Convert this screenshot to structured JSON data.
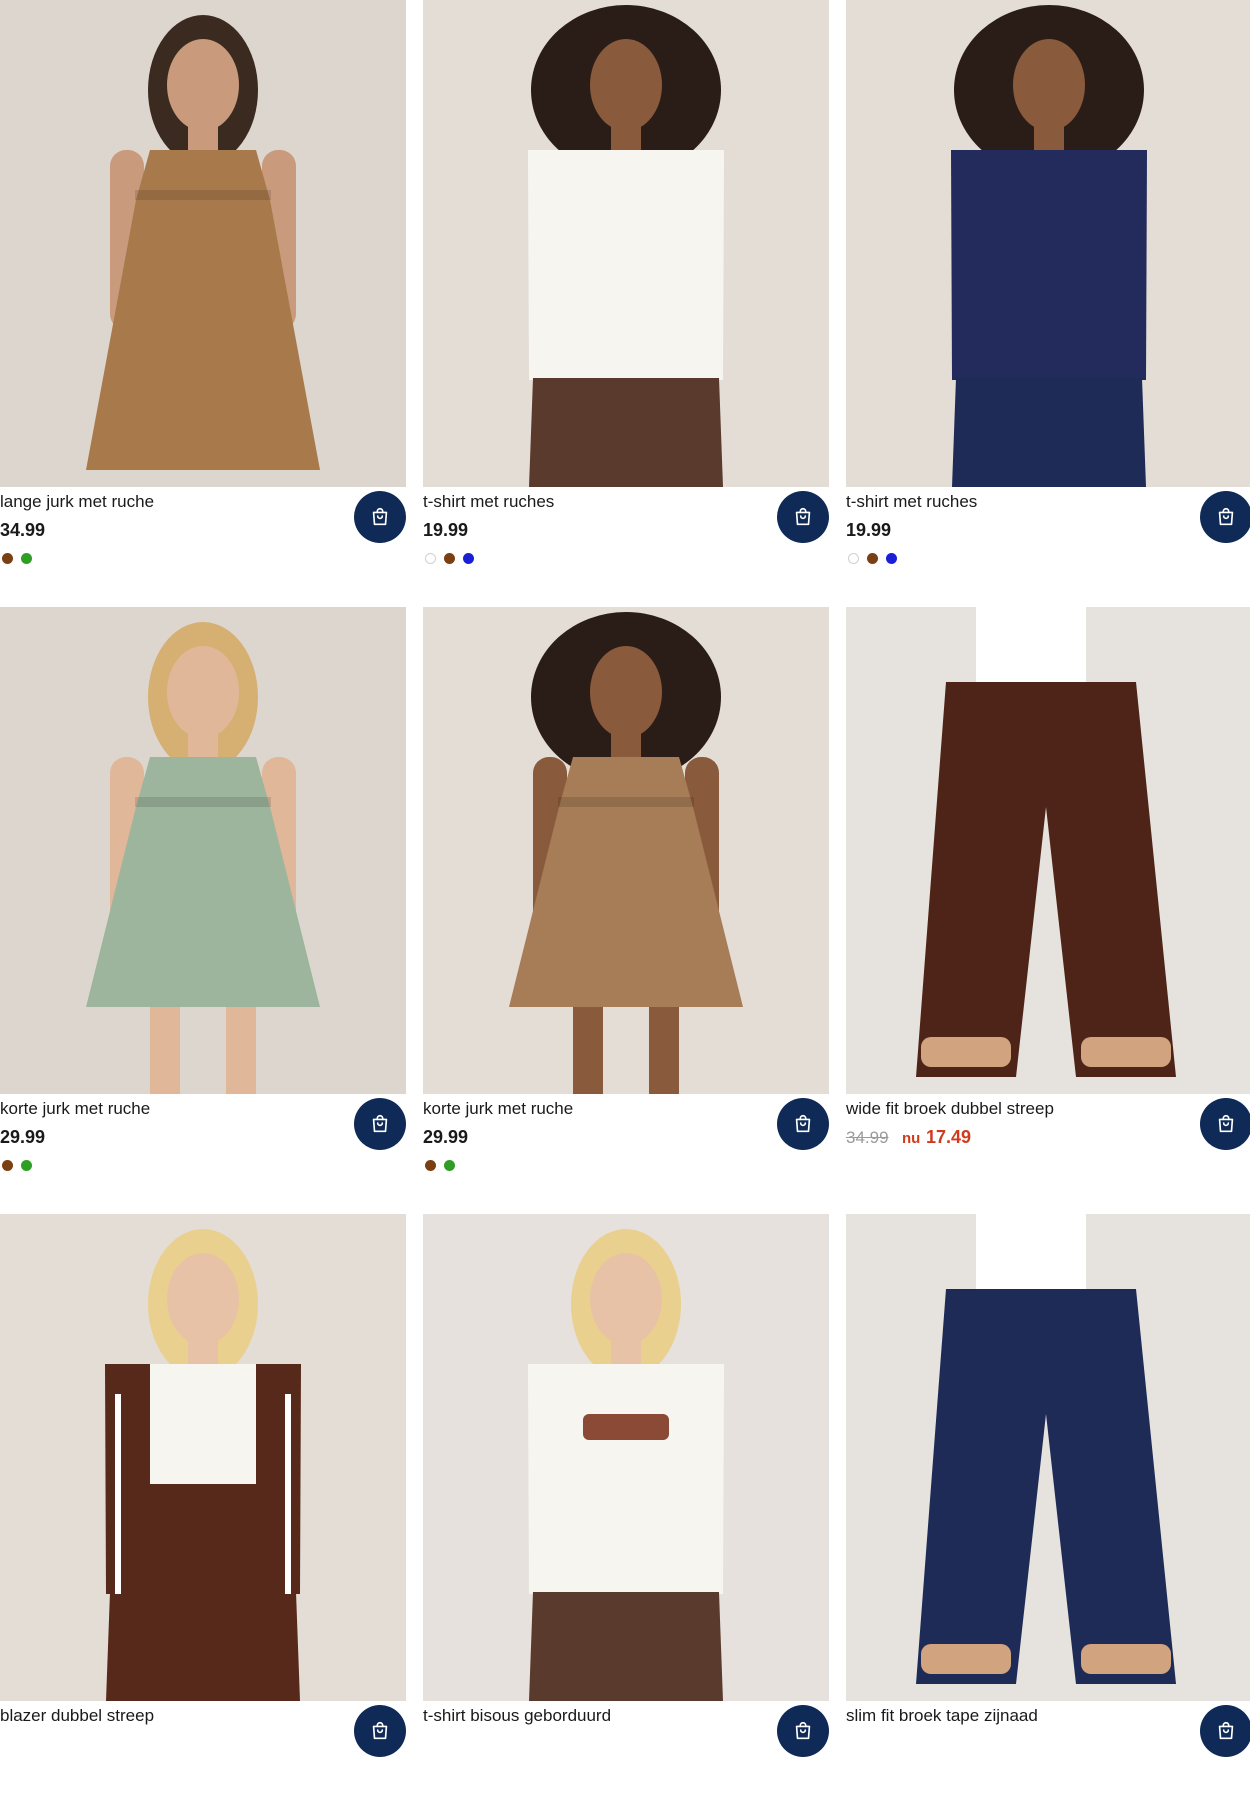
{
  "products": [
    {
      "title": "lange jurk met ruche",
      "price": "34.99",
      "swatches": [
        "#7a3f12",
        "#2e9e24"
      ],
      "palette": {
        "bg": "#ddd6cf",
        "garment": "#a8794a",
        "skin": "#c99a7c",
        "hair": "#3a2a20"
      }
    },
    {
      "title": "t-shirt met ruches",
      "price": "19.99",
      "swatches": [
        "#ffffff",
        "#7a3f12",
        "#1a1fd6"
      ],
      "palette": {
        "bg": "#e3ddd6",
        "garment": "#f7f5f0",
        "skin": "#8a5a3c",
        "hair": "#2a1d17"
      }
    },
    {
      "title": "t-shirt met ruches",
      "price": "19.99",
      "swatches": [
        "#ffffff",
        "#7a3f12",
        "#1a1fd6"
      ],
      "palette": {
        "bg": "#e3ddd6",
        "garment": "#232a5c",
        "skin": "#8a5a3c",
        "hair": "#2a1d17"
      }
    },
    {
      "title": "korte jurk met ruche",
      "price": "29.99",
      "swatches": [
        "#7a3f12",
        "#2e9e24"
      ],
      "palette": {
        "bg": "#ddd6cf",
        "garment": "#9db59c",
        "skin": "#e1b79a",
        "hair": "#d6b072"
      }
    },
    {
      "title": "korte jurk met ruche",
      "price": "29.99",
      "swatches": [
        "#7a3f12",
        "#2e9e24"
      ],
      "palette": {
        "bg": "#e3ddd6",
        "garment": "#a67d56",
        "skin": "#8a5a3c",
        "hair": "#2a1d17"
      }
    },
    {
      "title": "wide fit broek dubbel streep",
      "price_old": "34.99",
      "price_prefix": "nu",
      "price_sale": "17.49",
      "swatches": [],
      "palette": {
        "bg": "#e6e2dd",
        "garment": "#4e2418",
        "skin": "#d8a58a",
        "hair": "#ffffff"
      }
    },
    {
      "title": "blazer dubbel streep",
      "price": "",
      "swatches": [],
      "palette": {
        "bg": "#e3ddd6",
        "garment": "#57291a",
        "skin": "#e8c2a6",
        "hair": "#ead08e"
      }
    },
    {
      "title": "t-shirt bisous geborduurd",
      "price": "",
      "swatches": [],
      "palette": {
        "bg": "#e6e1dc",
        "garment": "#f7f5f0",
        "skin": "#e8c2a6",
        "hair": "#ead08e"
      }
    },
    {
      "title": "slim fit broek tape zijnaad",
      "price": "",
      "swatches": [],
      "palette": {
        "bg": "#e6e2dd",
        "garment": "#1f2b57",
        "skin": "#e1b79a",
        "hair": "#ffffff"
      }
    }
  ],
  "cart_icon": "shopping-bag-icon",
  "accent": "#0f2a57",
  "sale_color": "#d23a1e"
}
